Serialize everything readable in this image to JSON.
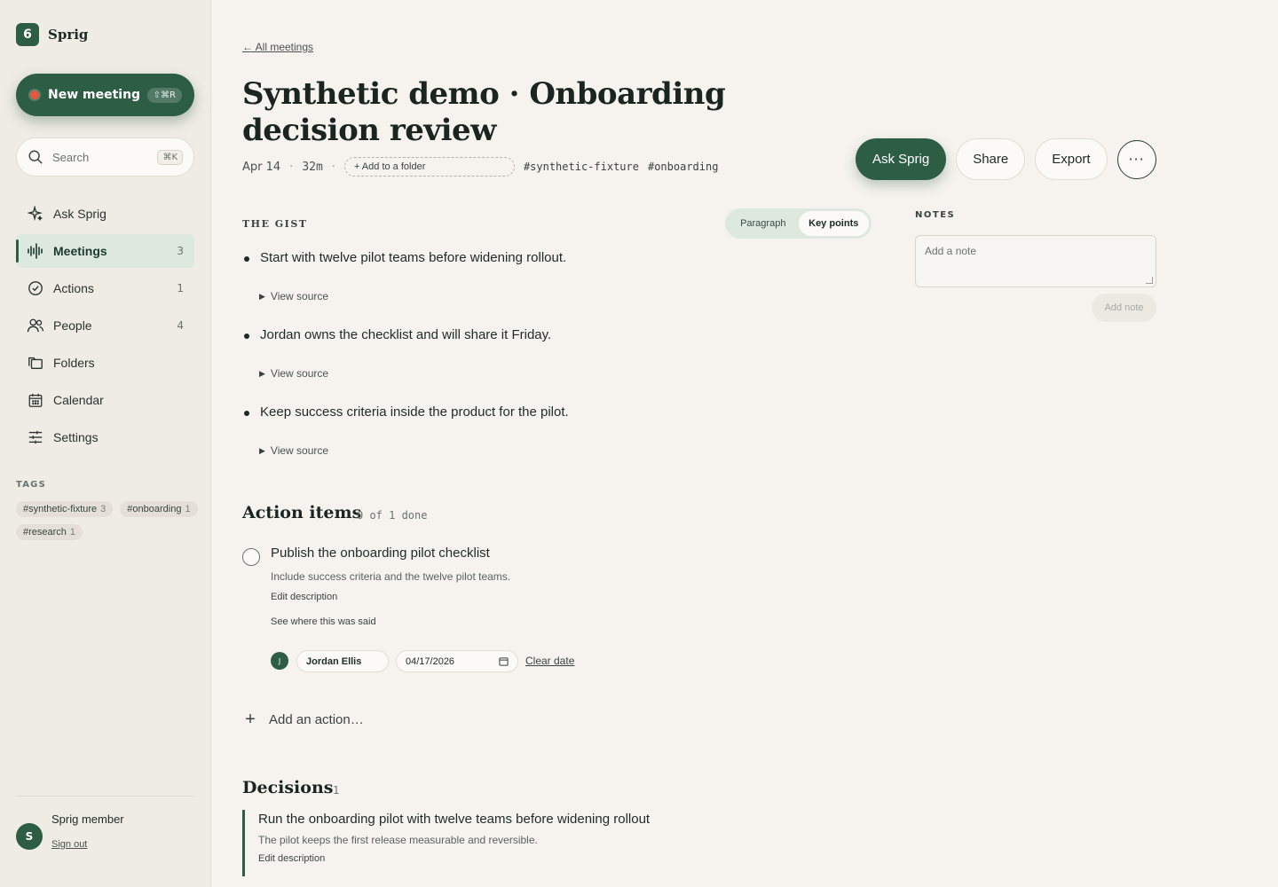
{
  "brand": {
    "name": "Sprig",
    "logo_glyph": "6"
  },
  "sidebar": {
    "new_meeting": {
      "label": "New meeting",
      "shortcut": "⇧⌘R"
    },
    "search": {
      "placeholder": "Search",
      "shortcut": "⌘K"
    },
    "items": [
      {
        "label": "Ask Sprig",
        "count": "",
        "icon": "sparkle-icon",
        "active": false
      },
      {
        "label": "Meetings",
        "count": "3",
        "icon": "waveform-icon",
        "active": true
      },
      {
        "label": "Actions",
        "count": "1",
        "icon": "check-circle-icon",
        "active": false
      },
      {
        "label": "People",
        "count": "4",
        "icon": "people-icon",
        "active": false
      },
      {
        "label": "Folders",
        "count": "",
        "icon": "folders-icon",
        "active": false
      },
      {
        "label": "Calendar",
        "count": "",
        "icon": "calendar-icon",
        "active": false
      },
      {
        "label": "Settings",
        "count": "",
        "icon": "sliders-icon",
        "active": false
      }
    ],
    "tags_heading": "TAGS",
    "tags": [
      {
        "name": "#synthetic-fixture",
        "count": "3"
      },
      {
        "name": "#onboarding",
        "count": "1"
      },
      {
        "name": "#research",
        "count": "1"
      }
    ],
    "user": {
      "initial": "S",
      "name": "Sprig member",
      "sign_out": "Sign out"
    }
  },
  "header": {
    "back_link": "← All meetings",
    "title": "Synthetic demo · Onboarding decision review",
    "date": "Apr 14",
    "duration": "32m",
    "folder_button": "+ Add to a folder",
    "tags": [
      "#synthetic-fixture",
      "#onboarding"
    ],
    "actions": {
      "ask": "Ask Sprig",
      "share": "Share",
      "export": "Export",
      "more": "···"
    }
  },
  "gist": {
    "label": "THE GIST",
    "toggle": {
      "paragraph": "Paragraph",
      "key_points": "Key points",
      "selected": "Key points"
    },
    "items": [
      {
        "text": "Start with twelve pilot teams before widening rollout.",
        "source_label": "View source"
      },
      {
        "text": "Jordan owns the checklist and will share it Friday.",
        "source_label": "View source"
      },
      {
        "text": "Keep success criteria inside the product for the pilot.",
        "source_label": "View source"
      }
    ]
  },
  "notes": {
    "label": "NOTES",
    "placeholder": "Add a note",
    "button": "Add note"
  },
  "actions_section": {
    "heading": "Action items",
    "progress": "0 of 1 done",
    "item": {
      "title": "Publish the onboarding pilot checklist",
      "description": "Include success criteria and the twelve pilot teams.",
      "edit_label": "Edit description",
      "source_label": "See where this was said",
      "assignee_initial": "J",
      "assignee": "Jordan Ellis",
      "due_date": "04/17/2026",
      "clear_date": "Clear date"
    },
    "add_label": "Add an action…"
  },
  "decisions": {
    "heading": "Decisions",
    "count": "1",
    "item": {
      "title": "Run the onboarding pilot with twelve teams before widening rollout",
      "body": "The pilot keeps the first release measurable and reversible.",
      "edit_label": "Edit description"
    }
  },
  "colors": {
    "accent": "#2e5d45",
    "record": "#e4563d",
    "background": "#f6f3ee",
    "sidebar": "#efebe5"
  }
}
